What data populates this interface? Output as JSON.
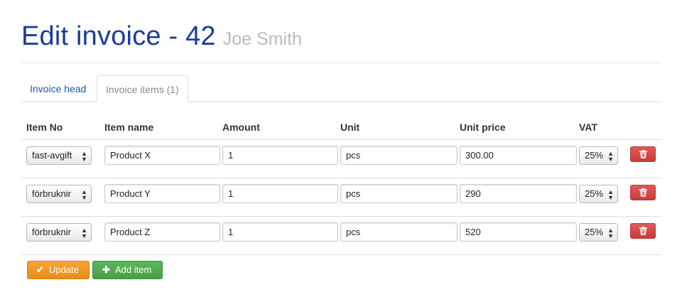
{
  "header": {
    "title": "Edit invoice - 42",
    "subtitle": "Joe Smith"
  },
  "tabs": [
    {
      "label": "Invoice head",
      "active": false
    },
    {
      "label": "Invoice items (1)",
      "active": true
    }
  ],
  "table": {
    "columns": [
      "Item No",
      "Item name",
      "Amount",
      "Unit",
      "Unit price",
      "VAT"
    ],
    "rows": [
      {
        "item_no": "fast-avgift",
        "item_name": "Product X",
        "amount": "1",
        "unit": "pcs",
        "unit_price": "300.00",
        "vat": "25%"
      },
      {
        "item_no": "förbruknir",
        "item_name": "Product Y",
        "amount": "1",
        "unit": "pcs",
        "unit_price": "290",
        "vat": "25%"
      },
      {
        "item_no": "förbruknir",
        "item_name": "Product Z",
        "amount": "1",
        "unit": "pcs",
        "unit_price": "520",
        "vat": "25%"
      }
    ]
  },
  "actions": {
    "update_label": "Update",
    "add_label": "Add item"
  },
  "icons": {
    "update": "check-icon",
    "add": "plus-icon",
    "delete": "trash-icon"
  },
  "colors": {
    "title": "#1a3d9b",
    "tab_link": "#1e5aa8",
    "update": "#f0981f",
    "add": "#51ac51",
    "delete": "#d44a4a"
  }
}
